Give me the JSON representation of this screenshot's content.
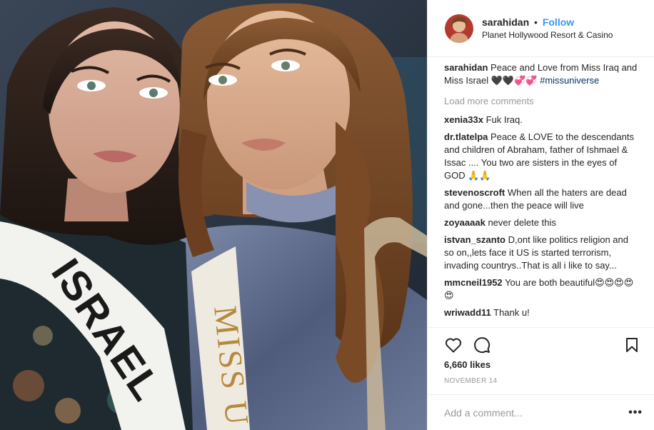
{
  "post": {
    "username": "sarahidan",
    "separator": "•",
    "follow_label": "Follow",
    "location": "Planet Hollywood Resort & Casino",
    "photo": {
      "sash_left_text": "ISRAEL",
      "sash_right_text": "MISS U"
    }
  },
  "caption": {
    "user": "sarahidan",
    "text": "Peace and Love from Miss Iraq and Miss Israel 🖤🖤💞💞",
    "hashtag": "#missuniverse"
  },
  "load_more": "Load more comments",
  "comments": [
    {
      "user": "xenia33x",
      "text": "Fuk Iraq."
    },
    {
      "user": "dr.tlatelpa",
      "text": "Peace & LOVE to the descendants and children of Abraham, father of Ishmael & Issac .... You two are sisters in the eyes of GOD 🙏🙏"
    },
    {
      "user": "stevenoscroft",
      "text": "When all the haters are dead and gone...then the peace will live"
    },
    {
      "user": "zoyaaaak",
      "text": "never delete this"
    },
    {
      "user": "istvan_szanto",
      "text": "D,ont like politics religion and so on,,lets face it US is started terrorism, invading countrys..That is all i like to say..."
    },
    {
      "user": "mmcneil1952",
      "text": "You are both beautiful😍😍😍😍😍"
    },
    {
      "user": "wriwadd11",
      "text": "Thank u!"
    }
  ],
  "actions": {
    "like_icon": "heart-icon",
    "comment_icon": "comment-icon",
    "save_icon": "bookmark-icon"
  },
  "likes": "6,660 likes",
  "date": "NOVEMBER 14",
  "add_comment_placeholder": "Add a comment...",
  "more_label": "•••",
  "colors": {
    "follow": "#3897f0",
    "hashtag": "#003569",
    "muted": "#999999",
    "border": "#efefef"
  }
}
